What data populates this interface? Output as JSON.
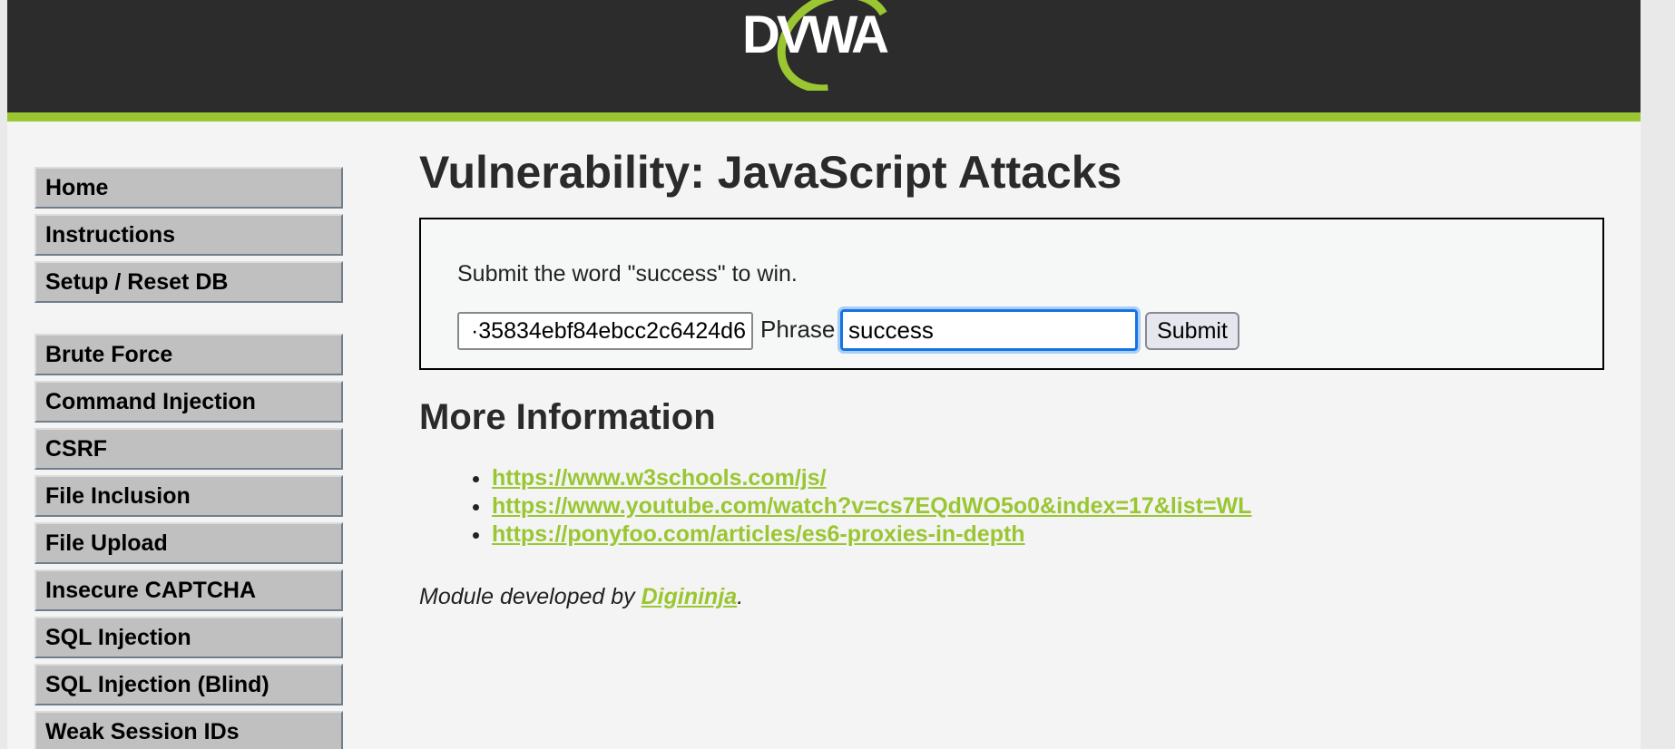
{
  "header": {
    "logo_text": "DVWA",
    "accent_color": "#9ac632",
    "background_color": "#2c2c2c"
  },
  "sidebar": {
    "groups": [
      {
        "items": [
          {
            "label": "Home"
          },
          {
            "label": "Instructions"
          },
          {
            "label": "Setup / Reset DB"
          }
        ]
      },
      {
        "items": [
          {
            "label": "Brute Force"
          },
          {
            "label": "Command Injection"
          },
          {
            "label": "CSRF"
          },
          {
            "label": "File Inclusion"
          },
          {
            "label": "File Upload"
          },
          {
            "label": "Insecure CAPTCHA"
          },
          {
            "label": "SQL Injection"
          },
          {
            "label": "SQL Injection (Blind)"
          },
          {
            "label": "Weak Session IDs"
          }
        ]
      }
    ]
  },
  "main": {
    "title": "Vulnerability: JavaScript Attacks",
    "instruction": "Submit the word \"success\" to win.",
    "token_value": "·35834ebf84ebcc2c6424d6",
    "phrase_label": "Phrase",
    "phrase_value": "success",
    "submit_label": "Submit",
    "more_info_title": "More Information",
    "links": [
      "https://www.w3schools.com/js/",
      "https://www.youtube.com/watch?v=cs7EQdWO5o0&index=17&list=WL",
      "https://ponyfoo.com/articles/es6-proxies-in-depth"
    ],
    "credit_prefix": "Module developed by ",
    "credit_name": "Digininja",
    "credit_suffix": "."
  }
}
